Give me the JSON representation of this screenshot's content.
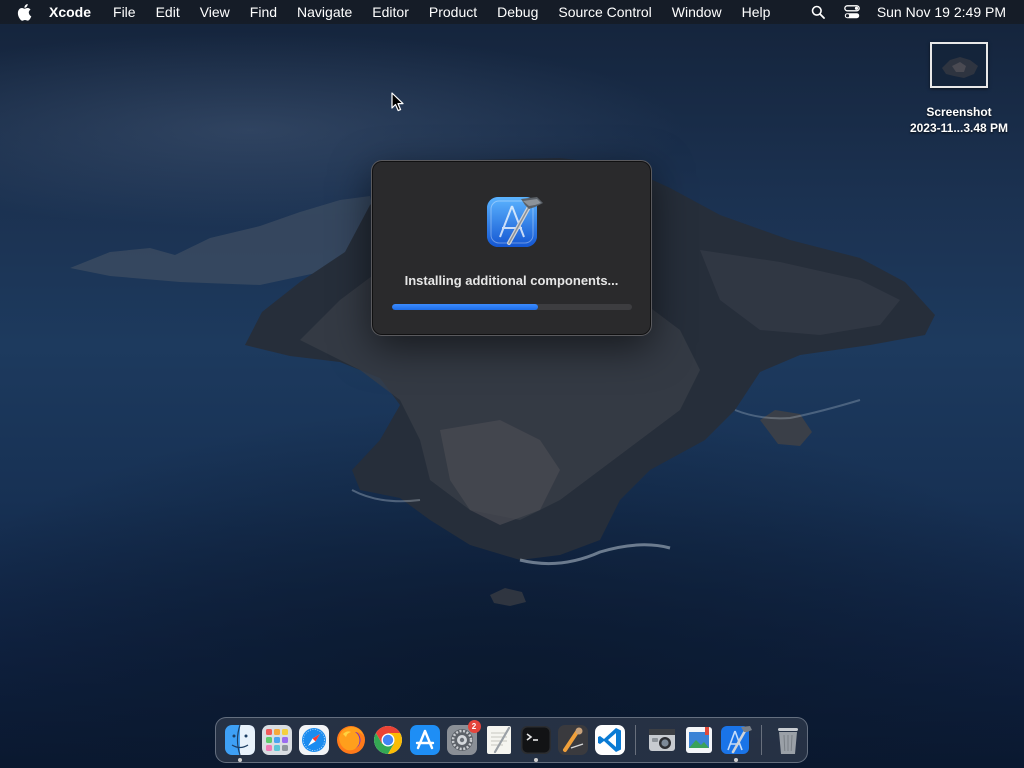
{
  "menubar": {
    "app_name": "Xcode",
    "menus": [
      "File",
      "Edit",
      "View",
      "Find",
      "Navigate",
      "Editor",
      "Product",
      "Debug",
      "Source Control",
      "Window",
      "Help"
    ],
    "clock": "Sun Nov 19  2:49 PM"
  },
  "desktop_file": {
    "line1": "Screenshot",
    "line2": "2023-11...3.48 PM"
  },
  "dialog": {
    "message": "Installing additional components...",
    "progress_fraction": 0.61
  },
  "dock": {
    "items": [
      "finder-icon",
      "launchpad-icon",
      "safari-icon",
      "firefox-icon",
      "chrome-icon",
      "app-store-icon",
      "system-settings-icon",
      "textedit-icon",
      "terminal-icon",
      "instruments-icon",
      "vscode-icon",
      "screenshot-icon",
      "preview-icon",
      "xcode-icon",
      "trash-icon"
    ],
    "settings_badge": "2"
  },
  "colors": {
    "accent": "#1e6ee8",
    "dialog_bg": "#2a2a2c"
  }
}
